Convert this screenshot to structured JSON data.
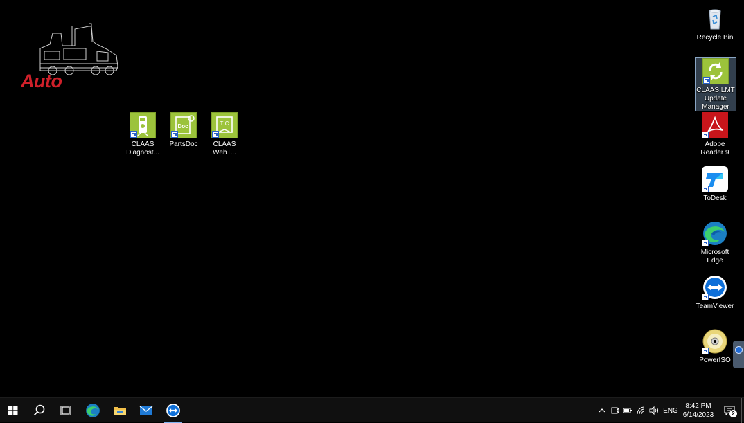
{
  "watermark": {
    "text": "Auto"
  },
  "desktop_icons": {
    "recycle_bin": {
      "label": "Recycle Bin",
      "icon": "recycle-bin-icon"
    },
    "claas_lmt": {
      "label": "CLAAS LMT\nUpdate\nManager",
      "icon": "refresh-arrows-icon"
    },
    "adobe_reader": {
      "label": "Adobe\nReader 9",
      "icon": "adobe-pdf-icon"
    },
    "todesk": {
      "label": "ToDesk",
      "icon": "todesk-icon"
    },
    "edge": {
      "label": "Microsoft\nEdge",
      "icon": "edge-icon"
    },
    "teamviewer": {
      "label": "TeamViewer",
      "icon": "teamviewer-icon"
    },
    "poweriso": {
      "label": "PowerISO",
      "icon": "disc-icon"
    },
    "claas_diag": {
      "label": "CLAAS\nDiagnost...",
      "icon": "multimeter-icon"
    },
    "partsdoc": {
      "label": "PartsDoc",
      "icon": "doc-book-icon"
    },
    "claas_webt": {
      "label": "CLAAS\nWebT...",
      "icon": "tic-book-icon"
    }
  },
  "taskbar": {
    "items": [
      "start-icon",
      "search-icon",
      "task-view-icon",
      "edge-icon",
      "file-explorer-icon",
      "mail-icon",
      "teamviewer-icon"
    ],
    "active_item": "teamviewer-icon",
    "tray": {
      "language": "ENG",
      "icons": [
        "chevron-up-icon",
        "meet-now-icon",
        "battery-icon",
        "wifi-icon",
        "volume-icon"
      ]
    },
    "clock": {
      "time": "8:42 PM",
      "date": "6/14/2023"
    },
    "notifications": {
      "count": "2"
    }
  },
  "colors": {
    "desktop_bg": "#000000",
    "taskbar_bg": "#101010",
    "claas_green": "#9cc33b",
    "logo_red": "#d0202a"
  }
}
